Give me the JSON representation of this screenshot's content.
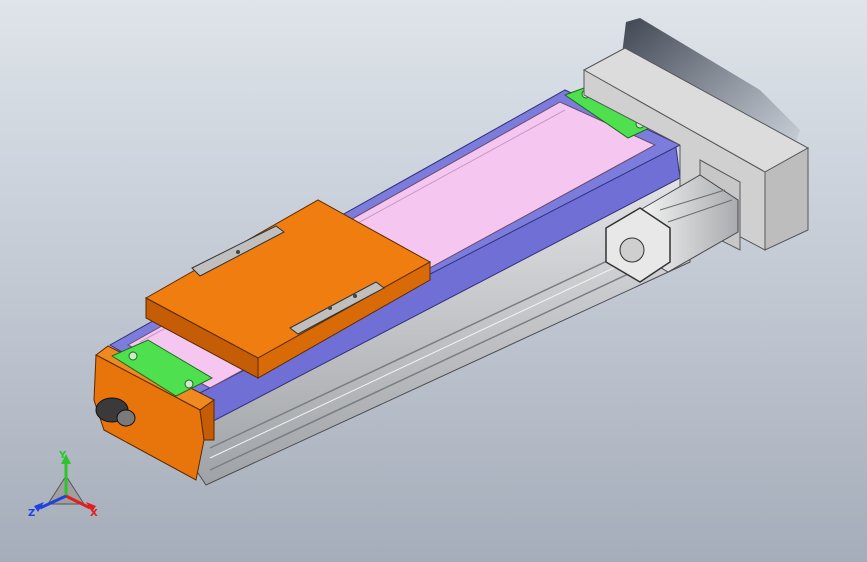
{
  "viewport": {
    "background_top": "#dfe4ea",
    "background_bottom": "#a5adba"
  },
  "model": {
    "colors": {
      "carriage": "#f07d0f",
      "carriage_shadow": "#c45d05",
      "end_cap": "#e8740c",
      "rail_cover": "#f4c6f0",
      "rail_side_strip": "#6f6fd6",
      "extrusion": "#c8cacd",
      "mount_plate": "#4fe04f",
      "gearbox_housing": "#dcdcdc",
      "motor": "#e6e6e6",
      "shadow": "#2d3340"
    }
  },
  "triad": {
    "y_label": "Y",
    "x_label": "X",
    "z_label": "Z",
    "y_color": "#2ec42e",
    "x_color": "#e02020",
    "z_color": "#2040e0"
  }
}
